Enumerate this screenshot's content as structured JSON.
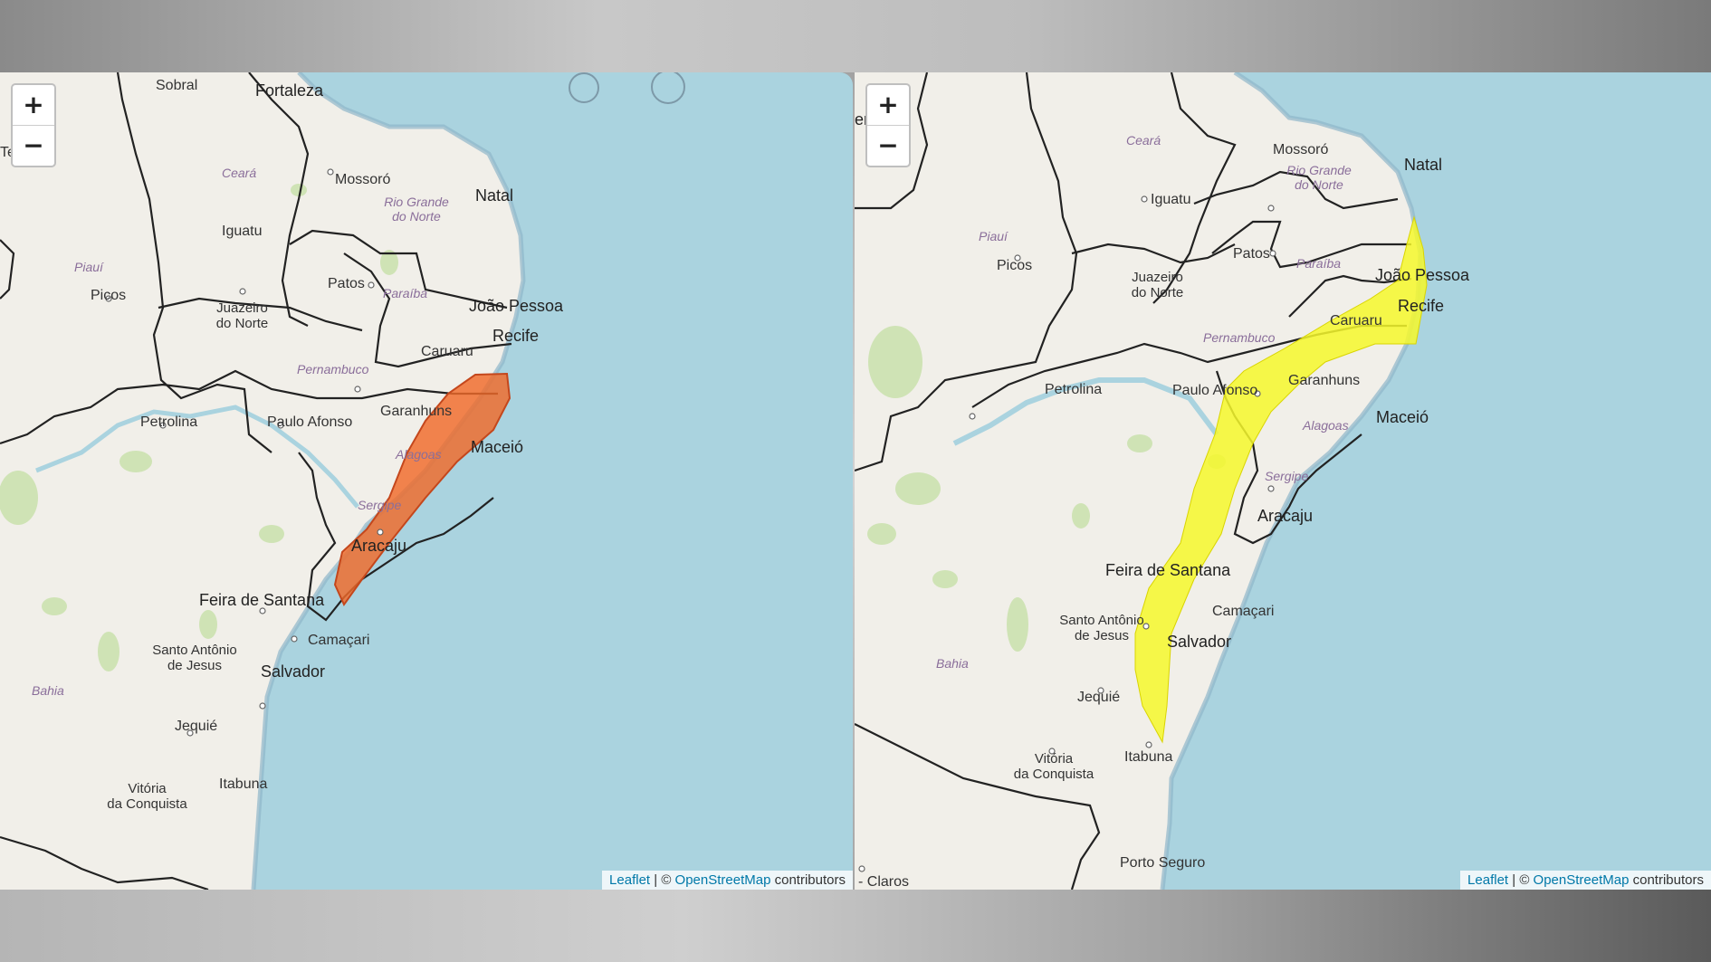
{
  "colors": {
    "sea": "#aad3df",
    "land": "#f1efe9",
    "orange_alert": "#f06a2a",
    "yellow_alert": "#f6f82c",
    "border": "#222222"
  },
  "controls": {
    "zoom_in": "+",
    "zoom_out": "−"
  },
  "attribution": {
    "leaflet": "Leaflet",
    "separator": " | © ",
    "osm": "OpenStreetMap",
    "suffix": " contributors"
  },
  "left_map": {
    "alert_color": "orange",
    "cities": {
      "sobral": "Sobral",
      "fortaleza": "Fortaleza",
      "te": "Te",
      "mossoro": "Mossoró",
      "natal": "Natal",
      "iguatu": "Iguatu",
      "patos": "Patos",
      "joao_pessoa": "João Pessoa",
      "recife": "Recife",
      "juazeiro": "Juazeiro\ndo Norte",
      "picos": "Picos",
      "caruaru": "Caruaru",
      "garanhuns": "Garanhuns",
      "petrolina": "Petrolina",
      "paulo_afonso": "Paulo Afonso",
      "maceio": "Maceió",
      "aracaju": "Aracaju",
      "feira": "Feira de Santana",
      "camacari": "Camaçari",
      "santo_antonio": "Santo Antônio\nde Jesus",
      "salvador": "Salvador",
      "jequie": "Jequié",
      "itabuna": "Itabuna",
      "vitoria": "Vitória\nda Conquista"
    },
    "states": {
      "ceara": "Ceará",
      "rgn": "Rio Grande\ndo Norte",
      "piaui": "Piauí",
      "paraiba": "Paraíba",
      "pernambuco": "Pernambuco",
      "alagoas": "Alagoas",
      "sergipe": "Sergipe",
      "bahia": "Bahia"
    }
  },
  "right_map": {
    "alert_color": "yellow",
    "cities": {
      "teresina": "eresina",
      "mossoro": "Mossoró",
      "natal": "Natal",
      "iguatu": "Iguatu",
      "picos": "Picos",
      "juazeiro": "Juazeiro\ndo Norte",
      "patos": "Patos",
      "joao_pessoa": "João Pessoa",
      "recife": "Recife",
      "caruaru": "Caruaru",
      "petrolina": "Petrolina",
      "paulo_afonso": "Paulo Afonso",
      "garanhuns": "Garanhuns",
      "maceio": "Maceió",
      "aracaju": "Aracaju",
      "feira": "Feira de Santana",
      "santo_antonio": "Santo Antônio\nde Jesus",
      "camacari": "Camaçari",
      "salvador": "Salvador",
      "jequie": "Jequié",
      "itabuna": "Itabuna",
      "vitoria": "Vitória\nda Conquista",
      "porto_seguro": "Porto Seguro",
      "claros": "- Claros"
    },
    "states": {
      "ceara": "Ceará",
      "rgn": "Rio Grande\ndo Norte",
      "piaui": "Piauí",
      "paraiba": "Paraíba",
      "pernambuco": "Pernambuco",
      "alagoas": "Alagoas",
      "sergipe": "Sergipe",
      "bahia": "Bahia"
    }
  }
}
